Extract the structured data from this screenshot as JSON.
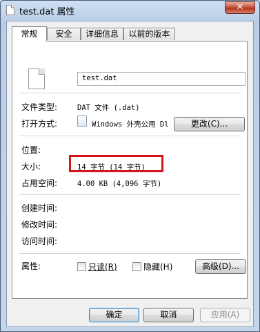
{
  "window": {
    "title": "test.dat 属性",
    "close_glyph": "✕"
  },
  "tabs": [
    {
      "label": "常规"
    },
    {
      "label": "安全"
    },
    {
      "label": "详细信息"
    },
    {
      "label": "以前的版本"
    }
  ],
  "general": {
    "filename": "test.dat",
    "file_type_label": "文件类型:",
    "file_type_value": "DAT 文件 (.dat)",
    "opens_with_label": "打开方式:",
    "opens_with_value": "Windows 外壳公用 Dl",
    "change_button": "更改(C)...",
    "location_label": "位置:",
    "size_label": "大小:",
    "size_value": "14 字节 (14 字节)",
    "size_on_disk_label": "占用空间:",
    "size_on_disk_value": "4.00 KB (4,096 字节)",
    "created_label": "创建时间:",
    "modified_label": "修改时间:",
    "accessed_label": "访问时间:",
    "attributes_label": "属性:",
    "readonly_label": "只读(R)",
    "hidden_label": "隐藏(H)",
    "advanced_button": "高级(D)...",
    "highlight_color": "#d4161c"
  },
  "buttons": {
    "ok": "确定",
    "cancel": "取消",
    "apply": "应用(A)"
  }
}
